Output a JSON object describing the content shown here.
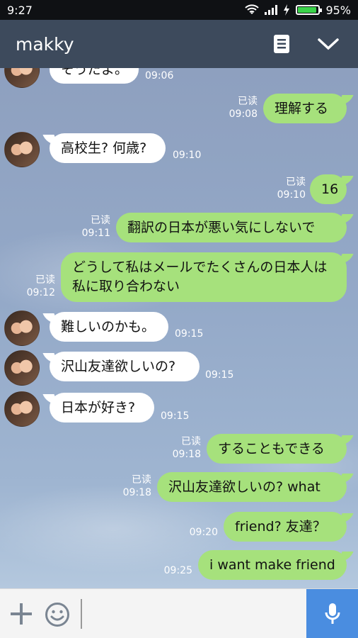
{
  "status_bar": {
    "time": "9:27",
    "battery": "95%"
  },
  "header": {
    "title": "makky"
  },
  "messages": [
    {
      "text": "そうだよ。",
      "time": "09:06"
    },
    {
      "text": "理解する",
      "read": "已读",
      "time": "09:08"
    },
    {
      "text": "高校生? 何歳?",
      "time": "09:10"
    },
    {
      "text": "16",
      "read": "已读",
      "time": "09:10"
    },
    {
      "text": "翻訳の日本が悪い気にしないで",
      "read": "已读",
      "time": "09:11"
    },
    {
      "text": "どうして私はメールでたくさんの日本人は私に取り合わない",
      "read": "已读",
      "time": "09:12"
    },
    {
      "text": "難しいのかも。",
      "time": "09:15"
    },
    {
      "text": "沢山友達欲しいの?",
      "time": "09:15"
    },
    {
      "text": "日本が好き?",
      "time": "09:15"
    },
    {
      "text": "することもできる",
      "read": "已读",
      "time": "09:18"
    },
    {
      "text": "沢山友達欲しいの?  what",
      "read": "已读",
      "time": "09:18"
    },
    {
      "text": "friend?  友達？",
      "time": "09:20"
    },
    {
      "text": "i want make friend",
      "time": "09:25"
    }
  ],
  "input": {
    "placeholder": ""
  }
}
